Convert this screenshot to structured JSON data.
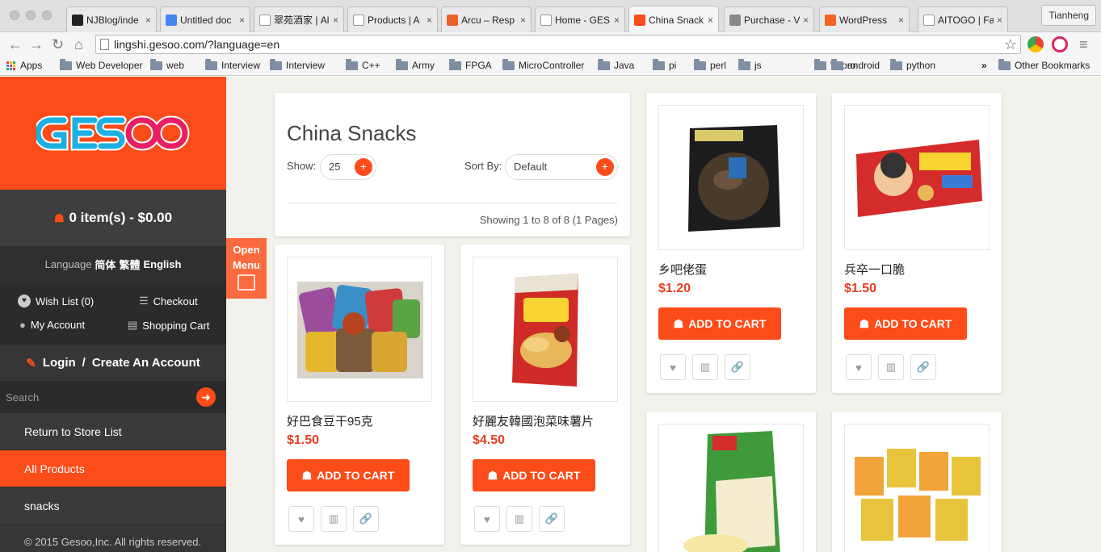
{
  "browser": {
    "tabs": [
      {
        "title": "NJBlog/inde",
        "icon": "github-icon",
        "color": "#222222"
      },
      {
        "title": "Untitled doc",
        "icon": "docs-icon",
        "color": "#4285f4"
      },
      {
        "title": "翠苑酒家 | Al",
        "icon": "page-icon",
        "color": "#ffffff"
      },
      {
        "title": "Products | A",
        "icon": "page-icon",
        "color": "#ffffff"
      },
      {
        "title": "Arcu – Resp",
        "icon": "k-icon",
        "color": "#e8622c"
      },
      {
        "title": "Home - GES",
        "icon": "page-icon",
        "color": "#ffffff"
      },
      {
        "title": "China Snack",
        "icon": "gesoo-icon",
        "color": "#fc4c19"
      },
      {
        "title": "Purchase - V",
        "icon": "loading-icon",
        "color": "#888888"
      },
      {
        "title": "WordPress",
        "icon": "wordpress-icon",
        "color": "#f26522"
      },
      {
        "title": "AITOGO | Fa",
        "icon": "page-icon",
        "color": "#ffffff"
      }
    ],
    "profile": "Tianheng",
    "url": "lingshi.gesoo.com/?language=en",
    "bookmarks": [
      "Apps",
      "Web Developer",
      "web",
      "Interview",
      "Interview",
      "C++",
      "Army",
      "FPGA",
      "MicroController",
      "Java",
      "pi",
      "perl",
      "js",
      "Wipro",
      "android",
      "python"
    ],
    "overflow": "»",
    "other_bookmarks": "Other Bookmarks"
  },
  "sidebar": {
    "cart_summary": "0 item(s) - $0.00",
    "language_label": "Language",
    "languages": [
      "简体",
      "繁體",
      "English"
    ],
    "wish_list": "Wish List (0)",
    "checkout": "Checkout",
    "my_account": "My Account",
    "shopping_cart": "Shopping Cart",
    "login": "Login",
    "separator": "/",
    "create_account": "Create An Account",
    "search_placeholder": "Search",
    "menu": [
      "Return to Store List",
      "All Products",
      "snacks"
    ],
    "copyright": "© 2015 Gesoo,Inc. All rights reserved.",
    "accent": "#fc4c19"
  },
  "open_menu": [
    "Open",
    "Menu"
  ],
  "header": {
    "title": "China Snacks",
    "show_label": "Show:",
    "show_value": "25",
    "sort_label": "Sort By:",
    "sort_value": "Default",
    "showing": "Showing 1 to 8 of 8 (1 Pages)"
  },
  "add_to_cart": "ADD TO CART",
  "products": [
    {
      "name": "好巴食豆干95克",
      "price": "$1.50"
    },
    {
      "name": "好麗友韓國泡菜味薯片",
      "price": "$4.50"
    },
    {
      "name": "乡吧佬蛋",
      "price": "$1.20"
    },
    {
      "name": "兵卒一口脆",
      "price": "$1.50"
    }
  ],
  "colors": {
    "price": "#e83d1f",
    "page_bg": "#f3f1ec"
  }
}
